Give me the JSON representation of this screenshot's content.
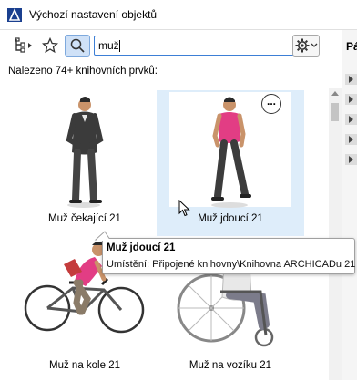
{
  "window": {
    "title": "Výchozí nastavení objektů"
  },
  "toolbar": {
    "search_value": "muž",
    "icons": [
      "library-tree-icon",
      "favorites-star-icon",
      "search-icon",
      "settings-gear-icon"
    ]
  },
  "results": {
    "found_text": "Nalezeno 74+ knihovních prvků:"
  },
  "items": [
    {
      "label": "Muž čekající 21"
    },
    {
      "label": "Muž jdoucí 21"
    },
    {
      "label": "Muž na kole 21"
    },
    {
      "label": "Muž na vozíku 21"
    }
  ],
  "more_button": {
    "label": "..."
  },
  "tooltip": {
    "title": "Muž jdoucí 21",
    "location": "Umístění: Připojené knihovny\\Knihovna ARCHICADu 21"
  },
  "right_panel": {
    "label": "Pá"
  },
  "colors": {
    "accent": "#3d7fd6",
    "selected_bg": "#deedfa",
    "pink_shirt": "#e23d84",
    "pants_dark": "#3c3c3c"
  }
}
